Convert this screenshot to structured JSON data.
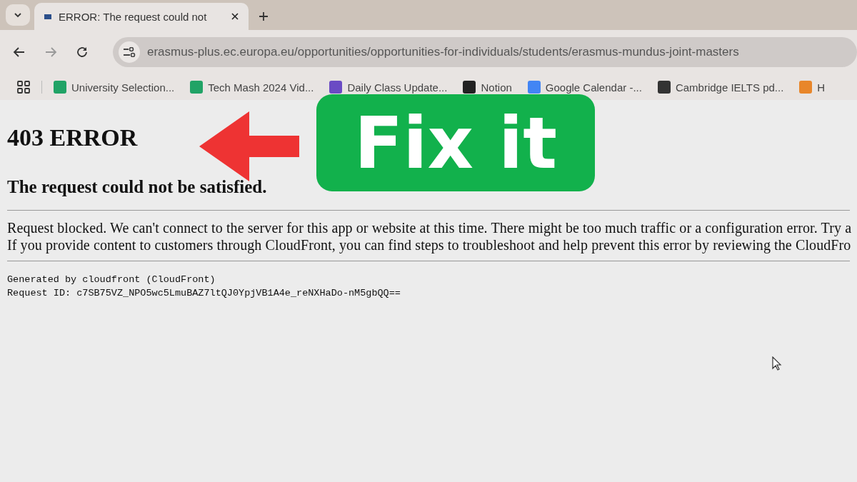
{
  "tabs": [
    {
      "title": "ERROR: The request could not",
      "selected": true
    }
  ],
  "address_bar": {
    "url": "erasmus-plus.ec.europa.eu/opportunities/opportunities-for-individuals/students/erasmus-mundus-joint-masters"
  },
  "bookmarks": [
    {
      "label": "University Selection...",
      "color": "#21a366"
    },
    {
      "label": "Tech Mash 2024 Vid...",
      "color": "#21a366"
    },
    {
      "label": "Daily Class Update...",
      "color": "#6a4bc4"
    },
    {
      "label": "Notion",
      "color": "#222222"
    },
    {
      "label": "Google Calendar -...",
      "color": "#4285f4"
    },
    {
      "label": "Cambridge IELTS pd...",
      "color": "#333333"
    },
    {
      "label": "H",
      "color": "#e8862a"
    }
  ],
  "page": {
    "heading": "403 ERROR",
    "subheading": "The request could not be satisfied.",
    "paragraph_lines": [
      "Request blocked. We can't connect to the server for this app or website at this time. There might be too much traffic or a configuration error. Try a",
      "If you provide content to customers through CloudFront, you can find steps to troubleshoot and help prevent this error by reviewing the CloudFro"
    ],
    "footer_lines": [
      "Generated by cloudfront (CloudFront)",
      "Request ID: c7SB75VZ_NPO5wc5LmuBAZ7ltQJ0YpjVB1A4e_reNXHaDo-nM5gbQQ=="
    ]
  },
  "overlay": {
    "badge": "Fix it"
  }
}
